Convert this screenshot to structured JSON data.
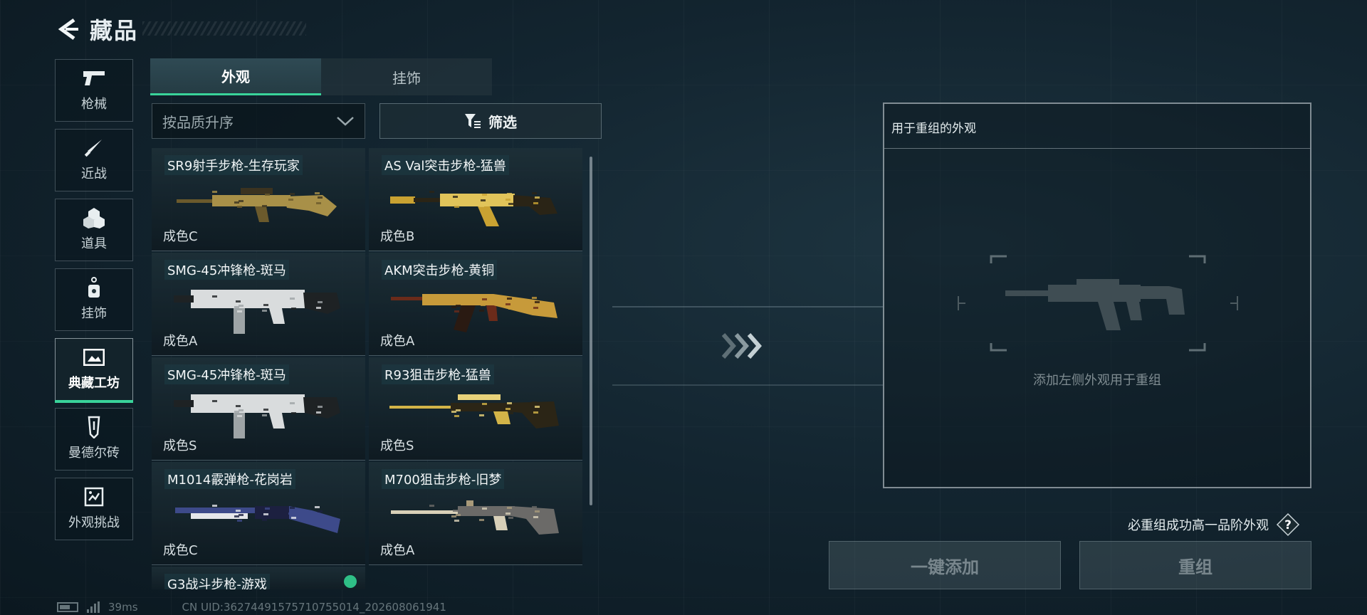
{
  "header": {
    "title": "藏品"
  },
  "sidebar": {
    "items": [
      {
        "label": "枪械",
        "icon": "pistol-icon"
      },
      {
        "label": "近战",
        "icon": "knife-icon"
      },
      {
        "label": "道具",
        "icon": "grenade-cluster-icon"
      },
      {
        "label": "挂饰",
        "icon": "charm-icon"
      },
      {
        "label": "典藏工坊",
        "icon": "workshop-frame-icon",
        "active": true
      },
      {
        "label": "曼德尔砖",
        "icon": "mandel-brick-icon"
      },
      {
        "label": "外观挑战",
        "icon": "challenge-icon"
      }
    ]
  },
  "tabs": [
    {
      "label": "外观",
      "active": true
    },
    {
      "label": "挂饰",
      "active": false
    }
  ],
  "sort": {
    "selected": "按品质升序"
  },
  "filter": {
    "label": "筛选"
  },
  "skins": [
    {
      "name": "SR9射手步枪-生存玩家",
      "grade": "成色C",
      "palette": [
        "#6b5a2c",
        "#a89048",
        "#3b3320"
      ]
    },
    {
      "name": "AS Val突击步枪-猛兽",
      "grade": "成色B",
      "palette": [
        "#c9a232",
        "#2a2416",
        "#e1c45a"
      ]
    },
    {
      "name": "SMG-45冲锋枪-斑马",
      "grade": "成色A",
      "palette": [
        "#d9dcdd",
        "#1e2224",
        "#9ea4a6"
      ]
    },
    {
      "name": "AKM突击步枪-黄铜",
      "grade": "成色A",
      "palette": [
        "#6b2b1a",
        "#c79a3a",
        "#2a1a12"
      ]
    },
    {
      "name": "SMG-45冲锋枪-斑马",
      "grade": "成色S",
      "palette": [
        "#d9dcdd",
        "#1e2224",
        "#9ea4a6"
      ]
    },
    {
      "name": "R93狙击步枪-猛兽",
      "grade": "成色S",
      "palette": [
        "#d3b448",
        "#2b2516",
        "#e8d27a"
      ]
    },
    {
      "name": "M1014霰弹枪-花岗岩",
      "grade": "成色C",
      "palette": [
        "#3d4a8a",
        "#e5e6ea",
        "#1c2040"
      ]
    },
    {
      "name": "M700狙击步枪-旧梦",
      "grade": "成色A",
      "palette": [
        "#d8d0b8",
        "#6b6a68",
        "#a89a7a"
      ]
    },
    {
      "name": "G3战斗步枪-游戏",
      "grade": ""
    }
  ],
  "recompose": {
    "panel_title": "用于重组的外观",
    "slot_hint": "添加左侧外观用于重组",
    "guarantee_text": "必重组成功高一品阶外观",
    "add_all_label": "一键添加",
    "recompose_label": "重组"
  },
  "status": {
    "ping": "39ms",
    "uid": "CN UID:36274491575710755014_202608061941"
  },
  "colors": {
    "accent": "#39d39a",
    "panel_border": "#dce6eb"
  }
}
